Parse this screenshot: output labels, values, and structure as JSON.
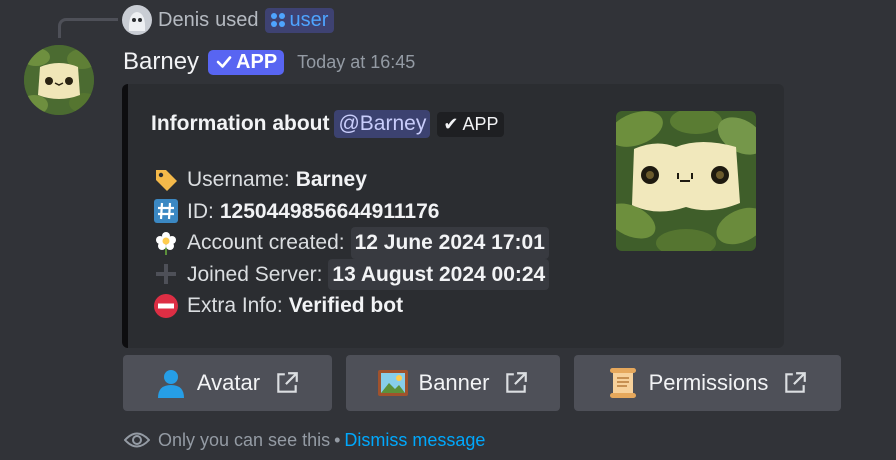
{
  "reply": {
    "user": "Denis",
    "action": "used",
    "command": "user"
  },
  "message": {
    "author": "Barney",
    "badge": "APP",
    "timestamp": "Today at 16:45"
  },
  "embed": {
    "title_prefix": "Information about",
    "mention": "@Barney",
    "mention_badge": "APP",
    "fields": [
      {
        "icon": "label-tag-icon",
        "label": "Username:",
        "value": "Barney"
      },
      {
        "icon": "hash-icon",
        "label": "ID:",
        "value": "1250449856644911176"
      },
      {
        "icon": "flower-icon",
        "label": "Account created:",
        "value": "12 June 2024 17:01"
      },
      {
        "icon": "plus-icon",
        "label": "Joined Server:",
        "value": "13 August 2024 00:24"
      },
      {
        "icon": "no-entry-icon",
        "label": "Extra Info:",
        "value": "Verified bot"
      }
    ]
  },
  "buttons": [
    {
      "icon": "person-icon",
      "label": "Avatar"
    },
    {
      "icon": "framed-picture-icon",
      "label": "Banner"
    },
    {
      "icon": "scroll-icon",
      "label": "Permissions"
    }
  ],
  "footer": {
    "text": "Only you can see this",
    "separator": "•",
    "dismiss": "Dismiss message"
  },
  "colors": {
    "background": "#313338",
    "embed": "#2b2d31",
    "blurple": "#5865f2",
    "button": "#4e5058",
    "link": "#00a8fc"
  }
}
